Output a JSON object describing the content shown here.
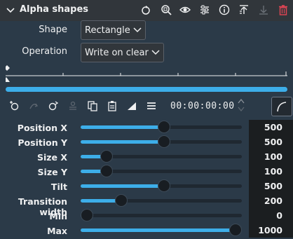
{
  "header": {
    "title": "Alpha shapes",
    "icons": [
      "chevron-down-icon",
      "reset-icon",
      "zoom-icon",
      "eye-icon",
      "settings-icon",
      "info-icon",
      "move-up-icon",
      "move-down-icon",
      "delete-icon"
    ]
  },
  "form": {
    "shape_label": "Shape",
    "shape_value": "Rectangle",
    "operation_label": "Operation",
    "operation_value": "Write on clear"
  },
  "toolbar": {
    "timecode": "00:00:00:00"
  },
  "params": [
    {
      "label": "Position X",
      "value": "500",
      "fraction": 0.52
    },
    {
      "label": "Position Y",
      "value": "500",
      "fraction": 0.52
    },
    {
      "label": "Size X",
      "value": "100",
      "fraction": 0.13
    },
    {
      "label": "Size Y",
      "value": "100",
      "fraction": 0.13
    },
    {
      "label": "Tilt",
      "value": "500",
      "fraction": 0.52
    },
    {
      "label": "Transition width",
      "value": "200",
      "fraction": 0.23
    },
    {
      "label": "Min",
      "value": "0",
      "fraction": 0.0
    },
    {
      "label": "Max",
      "value": "1000",
      "fraction": 1.0
    }
  ],
  "colors": {
    "accent": "#3daee9",
    "delete": "#da4453",
    "panel": "#2b3a48"
  }
}
